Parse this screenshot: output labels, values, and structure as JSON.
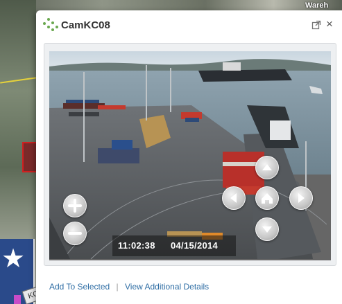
{
  "map": {
    "label_top_right": "Wareh",
    "tile_label": "KC"
  },
  "popup": {
    "title": "CamKC08",
    "header_icons": [
      "external-link-icon",
      "close-icon"
    ],
    "close_glyph": "×"
  },
  "camera": {
    "timestamp_time": "11:02:38",
    "timestamp_date": "04/15/2014",
    "controls": [
      "zoom-in",
      "zoom-out",
      "pan-up",
      "pan-down",
      "pan-left",
      "pan-right",
      "home"
    ]
  },
  "footer": {
    "add_link": "Add To Selected",
    "separator": "|",
    "details_link": "View Additional Details"
  },
  "colors": {
    "accent_link": "#2e6da4",
    "logo_green": "#6aa84f",
    "title_text": "#333333"
  }
}
